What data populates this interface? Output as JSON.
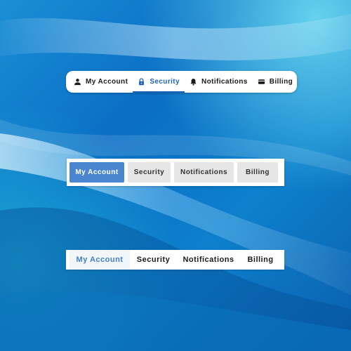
{
  "theme": {
    "accent": "#1e63b8",
    "boxed_active_bg": "#4a86d0",
    "boxed_inactive_bg": "#e6e6e6",
    "minimal_active_text": "#3f7fcf"
  },
  "icon_tabs": {
    "items": [
      {
        "label": "My Account",
        "icon": "user-icon",
        "active": false
      },
      {
        "label": "Security",
        "icon": "lock-icon",
        "active": true
      },
      {
        "label": "Notifications",
        "icon": "bell-icon",
        "active": false
      },
      {
        "label": "Billing",
        "icon": "credit-card-icon",
        "active": false
      }
    ]
  },
  "boxed_tabs": {
    "items": [
      {
        "label": "My Account",
        "active": true
      },
      {
        "label": "Security",
        "active": false
      },
      {
        "label": "Notifications",
        "active": false
      },
      {
        "label": "Billing",
        "active": false
      }
    ]
  },
  "minimal_tabs": {
    "items": [
      {
        "label": "My Account",
        "active": true
      },
      {
        "label": "Security",
        "active": false
      },
      {
        "label": "Notifications",
        "active": false
      },
      {
        "label": "Billing",
        "active": false
      }
    ]
  }
}
